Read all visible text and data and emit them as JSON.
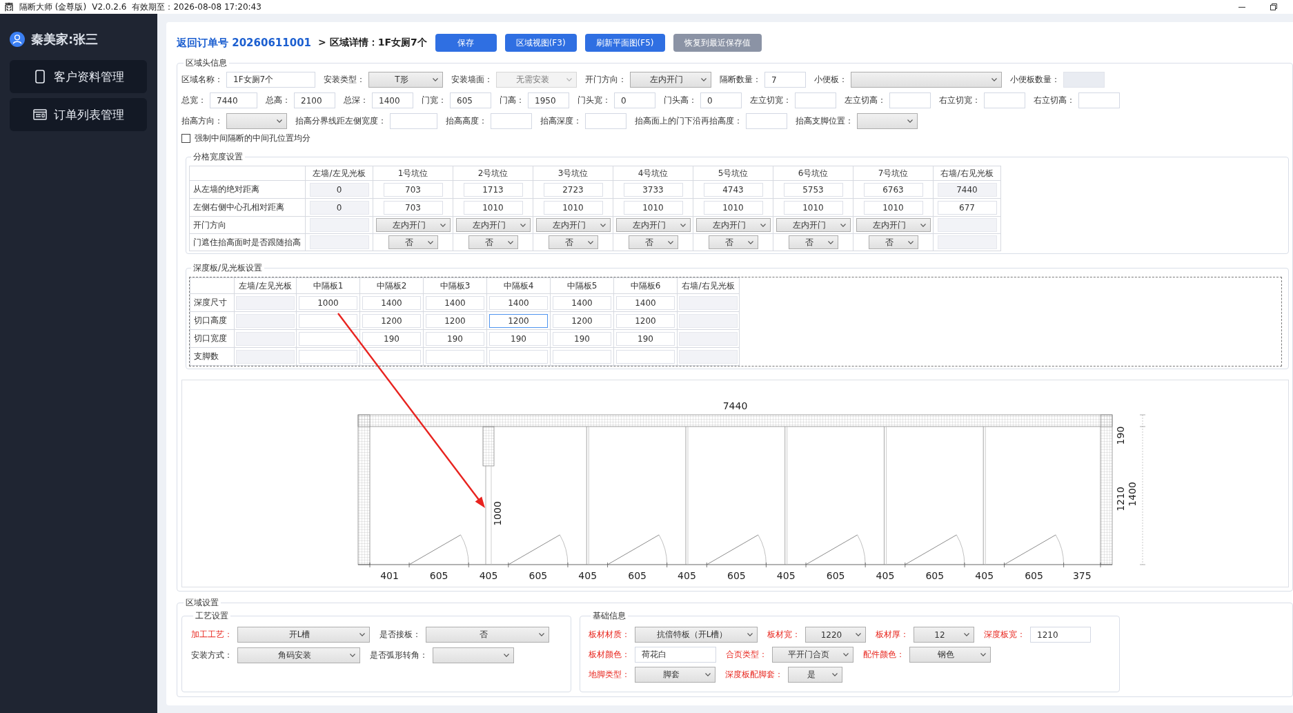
{
  "title_bar": {
    "app_name": "隔断大师 (金尊版)",
    "version": "V2.0.2.6",
    "expiry": "有效期至：2026-08-08 17:20:43"
  },
  "sidebar": {
    "user_name": "秦美家:张三",
    "items": [
      {
        "label": "客户资料管理",
        "kind": "phone",
        "selected": false
      },
      {
        "label": "订单列表管理",
        "kind": "form",
        "selected": false
      }
    ]
  },
  "header": {
    "back_link": "返回订单号 20260611001",
    "breadcrumb": "> 区域详情：1F女厕7个",
    "buttons": [
      {
        "label": "保存",
        "kind": "primary"
      },
      {
        "label": "区域视图(F3)",
        "kind": "primary"
      },
      {
        "label": "刷新平面图(F5)",
        "kind": "primary"
      },
      {
        "label": "恢复到最近保存值",
        "kind": "secondary"
      }
    ]
  },
  "region_header": {
    "title": "区域头信息",
    "rows": [
      {
        "fields": [
          {
            "label": "区域名称：",
            "kind": "text",
            "value": "1F女厕7个",
            "disabled": false
          },
          {
            "label": "安装类型：",
            "kind": "select",
            "value": "T形",
            "disabled": false
          },
          {
            "label": "安装墙面：",
            "kind": "select",
            "value": "无需安装",
            "disabled": true
          },
          {
            "label": "开门方向：",
            "kind": "select",
            "value": "左内开门",
            "disabled": false
          },
          {
            "label": "隔断数量：",
            "kind": "text",
            "value": "7",
            "disabled": false
          },
          {
            "label": "小便板：",
            "kind": "select",
            "disabled": false
          },
          {
            "label": "小便板数量：",
            "kind": "text",
            "disabled": true
          }
        ]
      },
      {
        "fields": [
          {
            "label": "总宽：",
            "kind": "text",
            "value": "7440",
            "disabled": false
          },
          {
            "label": "总高：",
            "kind": "text",
            "value": "2100",
            "disabled": false
          },
          {
            "label": "总深：",
            "kind": "text",
            "value": "1400",
            "disabled": false
          },
          {
            "label": "门宽：",
            "kind": "text",
            "value": "605",
            "disabled": false
          },
          {
            "label": "门高：",
            "kind": "text",
            "value": "1950",
            "disabled": false
          },
          {
            "label": "门头宽：",
            "kind": "text",
            "value": "0",
            "disabled": false
          },
          {
            "label": "门头高：",
            "kind": "text",
            "value": "0",
            "disabled": false
          },
          {
            "label": "左立切宽：",
            "kind": "text",
            "disabled": false
          },
          {
            "label": "左立切高：",
            "kind": "text",
            "disabled": false
          },
          {
            "label": "右立切宽：",
            "kind": "text",
            "disabled": false
          },
          {
            "label": "右立切高：",
            "kind": "text",
            "disabled": false
          }
        ]
      },
      {
        "fields": [
          {
            "label": "抬高方向：",
            "kind": "select",
            "disabled": false
          },
          {
            "label": "抬高分界线距左侧宽度：",
            "kind": "text",
            "disabled": false
          },
          {
            "label": "抬高高度：",
            "kind": "text",
            "disabled": false
          },
          {
            "label": "抬高深度：",
            "kind": "text",
            "disabled": false
          },
          {
            "label": "抬高面上的门下沿再抬高度：",
            "kind": "text",
            "disabled": false
          },
          {
            "label": "抬高支脚位置：",
            "kind": "select",
            "disabled": false
          }
        ]
      }
    ],
    "force_center": {
      "label": "强制中间隔断的中间孔位置均分",
      "checked": false
    }
  },
  "grid_table": {
    "title": "分格宽度设置",
    "columns": [
      "左墙/左见光板",
      "1号坑位",
      "2号坑位",
      "3号坑位",
      "4号坑位",
      "5号坑位",
      "6号坑位",
      "7号坑位",
      "右墙/右见光板"
    ],
    "rows": [
      {
        "label": "从左墙的绝对距离",
        "cells": [
          {
            "kind": "disabled",
            "value": "0"
          },
          {
            "kind": "input",
            "value": "703"
          },
          {
            "kind": "input",
            "value": "1713"
          },
          {
            "kind": "input",
            "value": "2723"
          },
          {
            "kind": "input",
            "value": "3733"
          },
          {
            "kind": "input",
            "value": "4743"
          },
          {
            "kind": "input",
            "value": "5753"
          },
          {
            "kind": "input",
            "value": "6763"
          },
          {
            "kind": "disabled",
            "value": "7440"
          }
        ]
      },
      {
        "label": "左侧右侧中心孔相对距离",
        "cells": [
          {
            "kind": "disabled",
            "value": "0"
          },
          {
            "kind": "input",
            "value": "703"
          },
          {
            "kind": "input",
            "value": "1010"
          },
          {
            "kind": "input",
            "value": "1010"
          },
          {
            "kind": "input",
            "value": "1010"
          },
          {
            "kind": "input",
            "value": "1010"
          },
          {
            "kind": "input",
            "value": "1010"
          },
          {
            "kind": "input",
            "value": "1010"
          },
          {
            "kind": "input",
            "value": "677"
          }
        ]
      },
      {
        "label": "开门方向",
        "cells": [
          {
            "kind": "disabled"
          },
          {
            "kind": "select",
            "value": "左内开门"
          },
          {
            "kind": "select",
            "value": "左内开门"
          },
          {
            "kind": "select",
            "value": "左内开门"
          },
          {
            "kind": "select",
            "value": "左内开门"
          },
          {
            "kind": "select",
            "value": "左内开门"
          },
          {
            "kind": "select",
            "value": "左内开门"
          },
          {
            "kind": "select",
            "value": "左内开门"
          },
          {
            "kind": "disabled"
          }
        ]
      },
      {
        "label": "门遮住抬高面时是否跟随抬高",
        "cells": [
          {
            "kind": "disabled"
          },
          {
            "kind": "select",
            "value": "否"
          },
          {
            "kind": "select",
            "value": "否"
          },
          {
            "kind": "select",
            "value": "否"
          },
          {
            "kind": "select",
            "value": "否"
          },
          {
            "kind": "select",
            "value": "否"
          },
          {
            "kind": "select",
            "value": "否"
          },
          {
            "kind": "select",
            "value": "否"
          },
          {
            "kind": "disabled"
          }
        ]
      }
    ]
  },
  "depth_table": {
    "title": "深度板/见光板设置",
    "columns": [
      "左墙/左见光板",
      "中隔板1",
      "中隔板2",
      "中隔板3",
      "中隔板4",
      "中隔板5",
      "中隔板6",
      "右墙/右见光板"
    ],
    "rows": [
      {
        "label": "深度尺寸",
        "cells": [
          {
            "kind": "disabled",
            "focused": false
          },
          {
            "kind": "input",
            "value": "1000",
            "focused": false
          },
          {
            "kind": "input",
            "value": "1400",
            "focused": false
          },
          {
            "kind": "input",
            "value": "1400",
            "focused": false
          },
          {
            "kind": "input",
            "value": "1400",
            "focused": false
          },
          {
            "kind": "input",
            "value": "1400",
            "focused": false
          },
          {
            "kind": "input",
            "value": "1400",
            "focused": false
          },
          {
            "kind": "disabled",
            "focused": false
          }
        ]
      },
      {
        "label": "切口高度",
        "cells": [
          {
            "kind": "disabled",
            "focused": false
          },
          {
            "kind": "input",
            "focused": false
          },
          {
            "kind": "input",
            "value": "1200",
            "focused": false
          },
          {
            "kind": "input",
            "value": "1200",
            "focused": false
          },
          {
            "kind": "input",
            "value": "1200",
            "focused": true
          },
          {
            "kind": "input",
            "value": "1200",
            "focused": false
          },
          {
            "kind": "input",
            "value": "1200",
            "focused": false
          },
          {
            "kind": "disabled",
            "focused": false
          }
        ]
      },
      {
        "label": "切口宽度",
        "cells": [
          {
            "kind": "disabled",
            "focused": false
          },
          {
            "kind": "input",
            "focused": false
          },
          {
            "kind": "input",
            "value": "190",
            "focused": false
          },
          {
            "kind": "input",
            "value": "190",
            "focused": false
          },
          {
            "kind": "input",
            "value": "190",
            "focused": false
          },
          {
            "kind": "input",
            "value": "190",
            "focused": false
          },
          {
            "kind": "input",
            "value": "190",
            "focused": false
          },
          {
            "kind": "disabled",
            "focused": false
          }
        ]
      },
      {
        "label": "支脚数",
        "cells": [
          {
            "kind": "disabled",
            "focused": false
          },
          {
            "kind": "input",
            "focused": false
          },
          {
            "kind": "input",
            "focused": false
          },
          {
            "kind": "input",
            "focused": false
          },
          {
            "kind": "input",
            "focused": false
          },
          {
            "kind": "input",
            "focused": false
          },
          {
            "kind": "input",
            "focused": false
          },
          {
            "kind": "disabled",
            "focused": false
          }
        ]
      }
    ]
  },
  "floor_plan": {
    "width_label": "7440",
    "bottom_dimensions": [
      "401",
      "605",
      "405",
      "605",
      "405",
      "605",
      "405",
      "605",
      "405",
      "605",
      "405",
      "605",
      "405",
      "605",
      "375"
    ],
    "side_dimensions": [
      "190",
      "1210",
      "1400"
    ],
    "panel_label": "1000"
  },
  "region_settings": {
    "title": "区域设置",
    "groups": [
      {
        "title": "工艺设置",
        "rows": [
          {
            "fields": [
              {
                "label": "加工工艺：",
                "kind": "select",
                "value": "开L槽",
                "required": true
              },
              {
                "label": "是否接板：",
                "kind": "select",
                "value": "否",
                "required": false
              }
            ]
          },
          {
            "fields": [
              {
                "label": "安装方式：",
                "kind": "select",
                "value": "角码安装",
                "required": false
              },
              {
                "label": "是否弧形转角：",
                "kind": "select",
                "required": false
              }
            ]
          }
        ]
      },
      {
        "title": "基础信息",
        "rows": [
          {
            "fields": [
              {
                "label": "板材材质：",
                "kind": "select",
                "value": "抗倍特板（开L槽）",
                "required": true
              },
              {
                "label": "板材宽：",
                "kind": "select",
                "value": "1220",
                "required": true
              },
              {
                "label": "板材厚：",
                "kind": "select",
                "value": "12",
                "required": true
              },
              {
                "label": "深度板宽：",
                "kind": "text",
                "value": "1210",
                "required": true
              }
            ]
          },
          {
            "fields": [
              {
                "label": "板材颜色：",
                "kind": "text",
                "value": "荷花白",
                "required": true
              },
              {
                "label": "合页类型：",
                "kind": "select",
                "value": "平开门合页",
                "required": true
              },
              {
                "label": "配件颜色：",
                "kind": "select",
                "value": "钢色",
                "required": true
              }
            ]
          },
          {
            "fields": [
              {
                "label": "地脚类型：",
                "kind": "select",
                "value": "脚套",
                "required": true
              },
              {
                "label": "深度板配脚套：",
                "kind": "select",
                "value": "是",
                "required": true
              }
            ]
          }
        ]
      }
    ]
  }
}
